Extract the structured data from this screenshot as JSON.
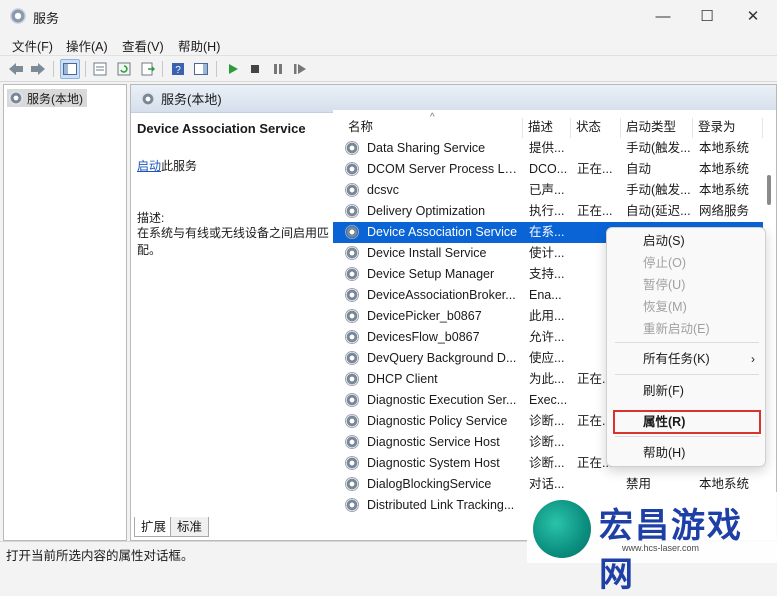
{
  "window": {
    "title": "服务",
    "controls": {
      "minimize": "—",
      "maximize": "☐",
      "close": "✕"
    }
  },
  "menubar": [
    "文件(F)",
    "操作(A)",
    "查看(V)",
    "帮助(H)"
  ],
  "toolbar_icons": [
    "back-icon",
    "forward-icon",
    "console-tree-icon",
    "properties-icon",
    "refresh-icon",
    "export-list-icon",
    "help-icon",
    "action-pane-icon",
    "start-service-icon",
    "stop-service-icon",
    "pause-service-icon",
    "restart-service-icon"
  ],
  "tree": {
    "root_label": "服务(本地)"
  },
  "content": {
    "header_title": "服务(本地)",
    "description": {
      "service_name": "Device Association Service",
      "start_link": "启动",
      "start_suffix": "此服务",
      "label": "描述:",
      "text": "在系统与有线或无线设备之间启用匹配。"
    },
    "columns": [
      "名称",
      "描述",
      "状态",
      "启动类型",
      "登录为"
    ],
    "rows": [
      {
        "name": "Data Sharing Service",
        "desc": "提供...",
        "status": "",
        "startup": "手动(触发...",
        "logon": "本地系统"
      },
      {
        "name": "DCOM Server Process La...",
        "desc": "DCO...",
        "status": "正在...",
        "startup": "自动",
        "logon": "本地系统"
      },
      {
        "name": "dcsvc",
        "desc": "已声...",
        "status": "",
        "startup": "手动(触发...",
        "logon": "本地系统"
      },
      {
        "name": "Delivery Optimization",
        "desc": "执行...",
        "status": "正在...",
        "startup": "自动(延迟...",
        "logon": "网络服务"
      },
      {
        "name": "Device Association Service",
        "desc": "在系...",
        "status": "",
        "startup": "",
        "logon": "",
        "selected": true
      },
      {
        "name": "Device Install Service",
        "desc": "使计...",
        "status": "",
        "startup": "",
        "logon": ""
      },
      {
        "name": "Device Setup Manager",
        "desc": "支持...",
        "status": "",
        "startup": "",
        "logon": ""
      },
      {
        "name": "DeviceAssociationBroker...",
        "desc": "Ena...",
        "status": "",
        "startup": "",
        "logon": ""
      },
      {
        "name": "DevicePicker_b0867",
        "desc": "此用...",
        "status": "",
        "startup": "",
        "logon": ""
      },
      {
        "name": "DevicesFlow_b0867",
        "desc": "允许...",
        "status": "",
        "startup": "",
        "logon": ""
      },
      {
        "name": "DevQuery Background D...",
        "desc": "使应...",
        "status": "",
        "startup": "",
        "logon": ""
      },
      {
        "name": "DHCP Client",
        "desc": "为此...",
        "status": "正在...",
        "startup": "",
        "logon": ""
      },
      {
        "name": "Diagnostic Execution Ser...",
        "desc": "Exec...",
        "status": "",
        "startup": "",
        "logon": ""
      },
      {
        "name": "Diagnostic Policy Service",
        "desc": "诊断...",
        "status": "正在...",
        "startup": "",
        "logon": ""
      },
      {
        "name": "Diagnostic Service Host",
        "desc": "诊断...",
        "status": "",
        "startup": "",
        "logon": ""
      },
      {
        "name": "Diagnostic System Host",
        "desc": "诊断...",
        "status": "正在...",
        "startup": "",
        "logon": ""
      },
      {
        "name": "DialogBlockingService",
        "desc": "对话...",
        "status": "",
        "startup": "禁用",
        "logon": "本地系统"
      },
      {
        "name": "Distributed Link Tracking...",
        "desc": "",
        "status": "",
        "startup": "",
        "logon": ""
      }
    ],
    "tabs": [
      "扩展",
      "标准"
    ]
  },
  "context_menu": {
    "items": [
      {
        "label": "启动(S)",
        "disabled": false
      },
      {
        "label": "停止(O)",
        "disabled": true
      },
      {
        "label": "暂停(U)",
        "disabled": true
      },
      {
        "label": "恢复(M)",
        "disabled": true
      },
      {
        "label": "重新启动(E)",
        "disabled": true
      },
      {
        "label": "所有任务(K)",
        "disabled": false,
        "submenu": true
      },
      {
        "label": "刷新(F)",
        "disabled": false
      },
      {
        "label": "属性(R)",
        "disabled": false,
        "highlighted": true
      },
      {
        "label": "帮助(H)",
        "disabled": false
      }
    ],
    "submenu_arrow": "›"
  },
  "statusbar": {
    "text": "打开当前所选内容的属性对话框。"
  },
  "watermark": {
    "text": "宏昌游戏网",
    "url": "www.hcs-laser.com"
  },
  "colors": {
    "selection": "#0a64d6",
    "highlight_border": "#d9342b",
    "link": "#1a56b5",
    "watermark_text": "#1e3fa6"
  }
}
